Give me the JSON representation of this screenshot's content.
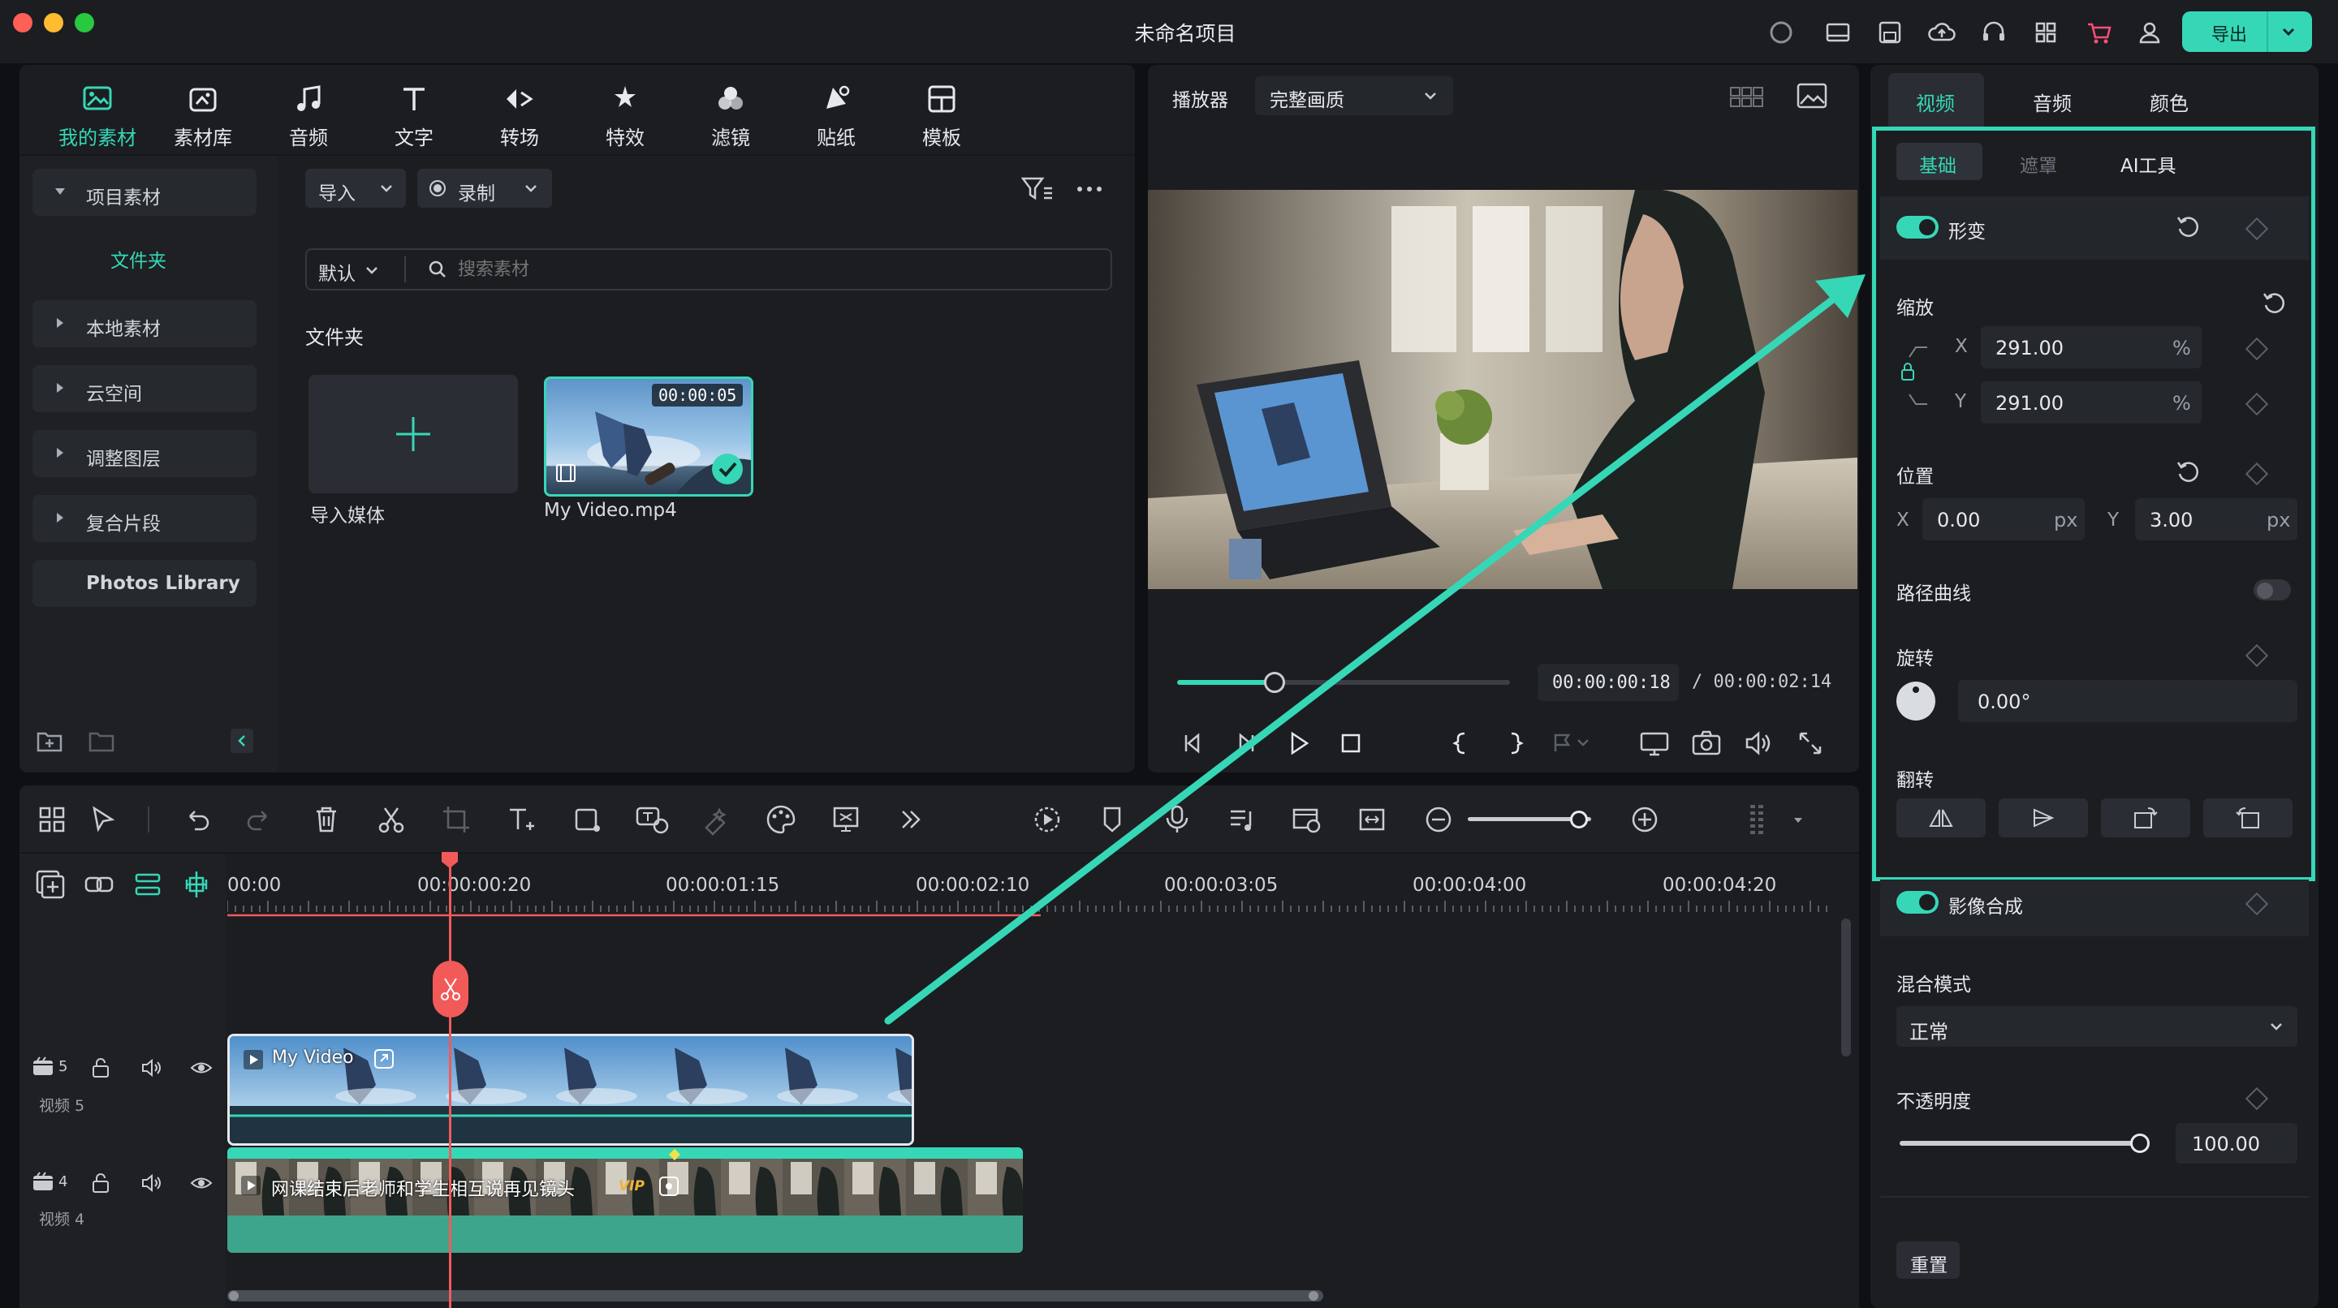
{
  "window": {
    "title": "未命名项目",
    "export_label": "导出"
  },
  "media_tabs": [
    {
      "label": "我的素材",
      "icon": "my-media-icon",
      "active": true
    },
    {
      "label": "素材库",
      "icon": "stock-media-icon"
    },
    {
      "label": "音频",
      "icon": "music-note-icon"
    },
    {
      "label": "文字",
      "icon": "text-icon"
    },
    {
      "label": "转场",
      "icon": "transition-icon"
    },
    {
      "label": "特效",
      "icon": "effects-icon"
    },
    {
      "label": "滤镜",
      "icon": "filters-icon"
    },
    {
      "label": "贴纸",
      "icon": "stickers-icon"
    },
    {
      "label": "模板",
      "icon": "templates-icon"
    }
  ],
  "sidebar": {
    "project_media": "项目素材",
    "folder": "文件夹",
    "local_media": "本地素材",
    "cloud": "云空间",
    "adjustment_layer": "调整图层",
    "compound_clip": "复合片段",
    "photos_library": "Photos Library"
  },
  "media_toolbar": {
    "import": "导入",
    "record": "录制",
    "sort": "默认",
    "search_placeholder": "搜索素材",
    "folder_heading": "文件夹"
  },
  "media_items": [
    {
      "label": "导入媒体"
    },
    {
      "label": "My Video.mp4",
      "duration": "00:00:05"
    }
  ],
  "player": {
    "label": "播放器",
    "quality": "完整画质",
    "current_time": "00:00:00:18",
    "total_time": "/  00:00:02:14",
    "progress": 0.29
  },
  "inspector": {
    "tabs": [
      "视频",
      "音频",
      "颜色"
    ],
    "subtabs": [
      "基础",
      "遮罩",
      "AI工具"
    ],
    "transform": "形变",
    "scale": {
      "label": "缩放",
      "x_label": "X",
      "x": "291.00",
      "y_label": "Y",
      "y": "291.00",
      "unit": "%"
    },
    "position": {
      "label": "位置",
      "x_label": "X",
      "x": "0.00",
      "y_label": "Y",
      "y": "3.00",
      "unit": "px"
    },
    "path_curve": "路径曲线",
    "rotate": {
      "label": "旋转",
      "value": "0.00°"
    },
    "flip": "翻转",
    "compositing": "影像合成",
    "blend_mode": {
      "label": "混合模式",
      "value": "正常"
    },
    "opacity": {
      "label": "不透明度",
      "value": "100.00",
      "level": 1.0
    },
    "reset": "重置"
  },
  "timeline": {
    "ruler": [
      "00:00",
      "00:00:00:20",
      "00:00:01:15",
      "00:00:02:10",
      "00:00:03:05",
      "00:00:04:00",
      "00:00:04:20"
    ],
    "tracks": [
      {
        "number": "5",
        "name": "视频 5",
        "clip": "My Video"
      },
      {
        "number": "4",
        "name": "视频 4",
        "clip": "网课结束后老师和学生相互说再见镜头",
        "badge": "VIP"
      }
    ]
  },
  "colors": {
    "accent": "#36d7b7",
    "playhead": "#f25a5a",
    "panel": "#1b1d21",
    "background": "#0e1013"
  }
}
